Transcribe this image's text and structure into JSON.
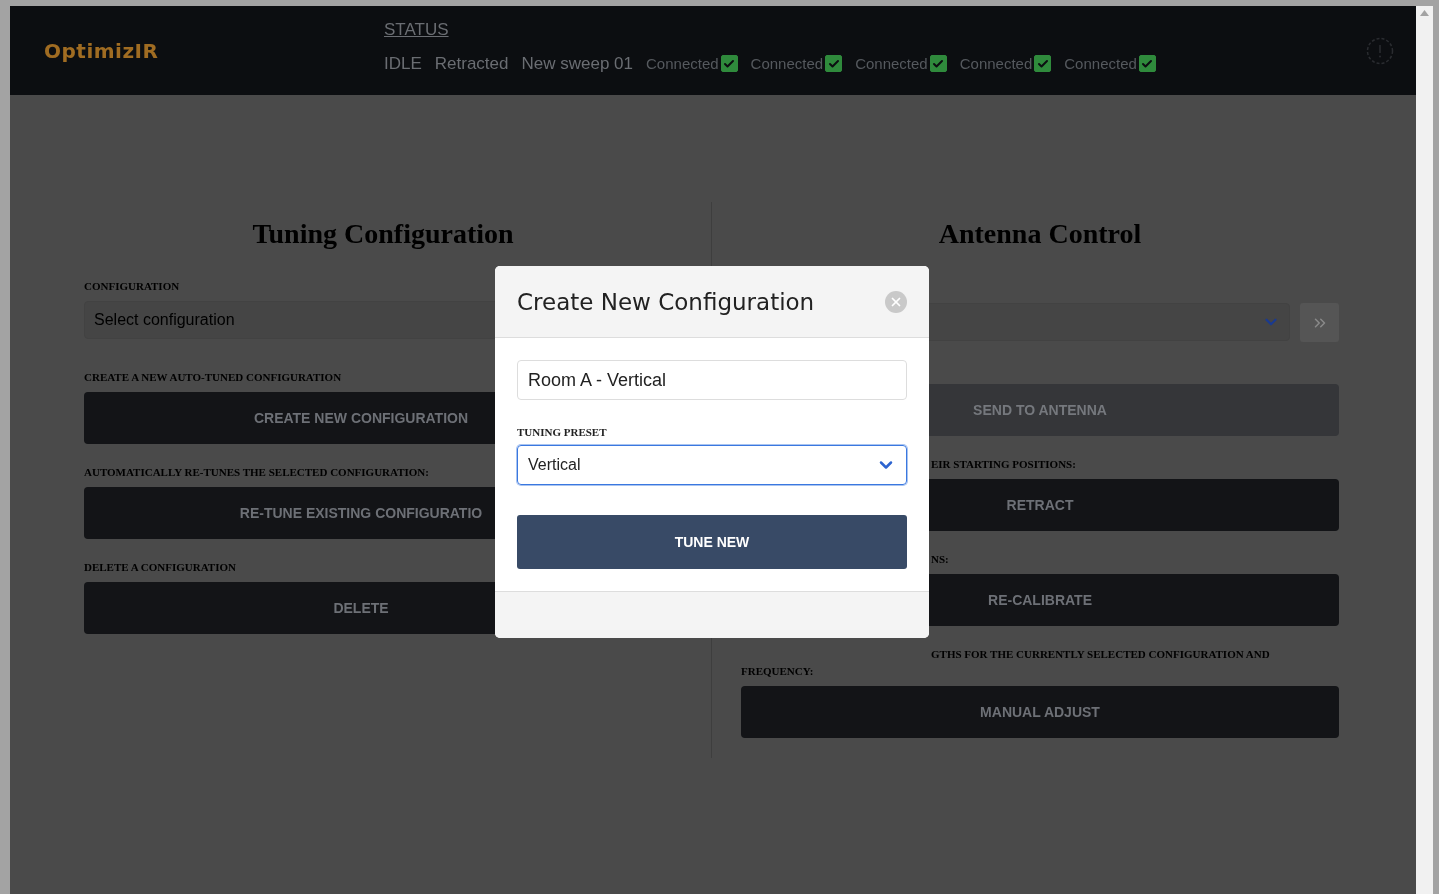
{
  "header": {
    "logo": "OptimizIR",
    "status_title": "STATUS",
    "status_values": [
      "IDLE",
      "Retracted",
      "New sweep 01"
    ],
    "connections": [
      {
        "label": "Connected",
        "checked": true
      },
      {
        "label": "Connected",
        "checked": true
      },
      {
        "label": "Connected",
        "checked": true
      },
      {
        "label": "Connected",
        "checked": true
      },
      {
        "label": "Connected",
        "checked": true
      }
    ]
  },
  "tuning": {
    "title": "Tuning Configuration",
    "items": [
      {
        "kind": "select",
        "label": [
          "CONFIGURATION"
        ],
        "placeholder": "Select configuration"
      },
      {
        "kind": "button",
        "label": [
          "CREATE A NEW AUTO-TUNED CONFIGURATION"
        ],
        "button": "CREATE NEW CONFIGURATION",
        "disabled": false
      },
      {
        "kind": "button",
        "label": [
          "AUTOMATICALLY RE-TUNES THE SELECTED CONFIGURATION:"
        ],
        "button": "RE-TUNE EXISTING CONFIGURATIO",
        "disabled": false
      },
      {
        "kind": "button",
        "label": [
          "DELETE A CONFIGURATION"
        ],
        "button": "DELETE",
        "disabled": false
      }
    ]
  },
  "antenna": {
    "title": "Antenna Control",
    "items": [
      {
        "kind": "select"
      },
      {
        "kind": "button",
        "button": "SEND TO ANTENNA",
        "disabled": true
      },
      {
        "kind": "button",
        "label": [
          "EIR STARTING POSITIONS:"
        ],
        "button": "RETRACT",
        "disabled": false
      },
      {
        "kind": "button",
        "label": [
          "NS:"
        ],
        "button": "RE-CALIBRATE",
        "disabled": false
      },
      {
        "kind": "button",
        "label": [
          "GTHS FOR THE CURRENTLY SELECTED CONFIGURATION AND",
          "FREQUENCY:"
        ],
        "button": "MANUAL ADJUST",
        "disabled": false
      }
    ]
  },
  "modal": {
    "title": "Create New Configuration",
    "name_value": "Room A - Vertical",
    "preset_label": "TUNING PRESET",
    "preset_value": "Vertical",
    "submit": "TUNE NEW"
  }
}
